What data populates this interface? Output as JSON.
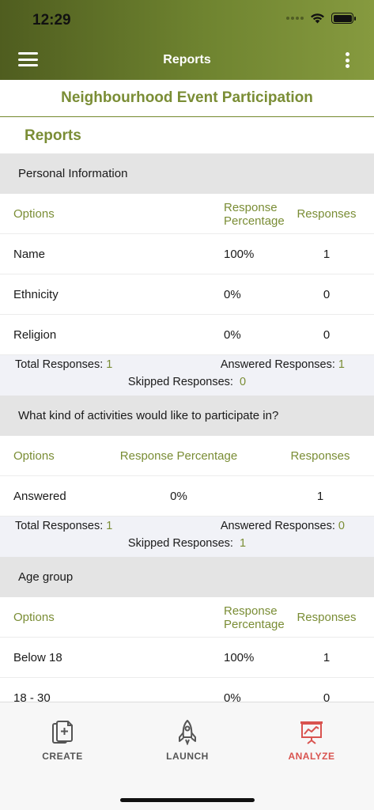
{
  "status": {
    "time": "12:29"
  },
  "navbar": {
    "title": "Reports"
  },
  "survey": {
    "title": "Neighbourhood Event Participation"
  },
  "reports_heading": "Reports",
  "sections": [
    {
      "title": "Personal Information",
      "headers": {
        "options": "Options",
        "percentage": "Response Percentage",
        "responses": "Responses"
      },
      "rows": [
        {
          "option": "Name",
          "percentage": "100%",
          "responses": "1"
        },
        {
          "option": "Ethnicity",
          "percentage": "0%",
          "responses": "0"
        },
        {
          "option": "Religion",
          "percentage": "0%",
          "responses": "0"
        }
      ],
      "summary": {
        "total_label": "Total Responses:",
        "total_value": "1",
        "answered_label": "Answered Responses:",
        "answered_value": "1",
        "skipped_label": "Skipped Responses:",
        "skipped_value": "0"
      }
    },
    {
      "title": "What kind of activities would like to participate in?",
      "headers": {
        "options": "Options",
        "percentage": "Response Percentage",
        "responses": "Responses"
      },
      "rows": [
        {
          "option": "Answered",
          "percentage": "0%",
          "responses": "1"
        }
      ],
      "summary": {
        "total_label": "Total Responses:",
        "total_value": "1",
        "answered_label": "Answered Responses:",
        "answered_value": "0",
        "skipped_label": "Skipped Responses:",
        "skipped_value": "1"
      }
    },
    {
      "title": "Age group",
      "headers": {
        "options": "Options",
        "percentage": "Response Percentage",
        "responses": "Responses"
      },
      "rows": [
        {
          "option": "Below 18",
          "percentage": "100%",
          "responses": "1"
        },
        {
          "option": "18 - 30",
          "percentage": "0%",
          "responses": "0"
        }
      ]
    }
  ],
  "tabbar": {
    "create": "CREATE",
    "launch": "LAUNCH",
    "analyze": "ANALYZE"
  },
  "colors": {
    "accent": "#7a8d35",
    "header_gradient_start": "#4f5d1f",
    "header_gradient_end": "#869a3f",
    "active_tab": "#d9534f",
    "section_bg": "#e4e4e4",
    "summary_bg": "#f1f2f7"
  },
  "icons": {
    "menu": "hamburger-icon",
    "more": "kebab-icon",
    "create": "document-add-icon",
    "launch": "rocket-icon",
    "analyze": "presentation-chart-icon"
  }
}
